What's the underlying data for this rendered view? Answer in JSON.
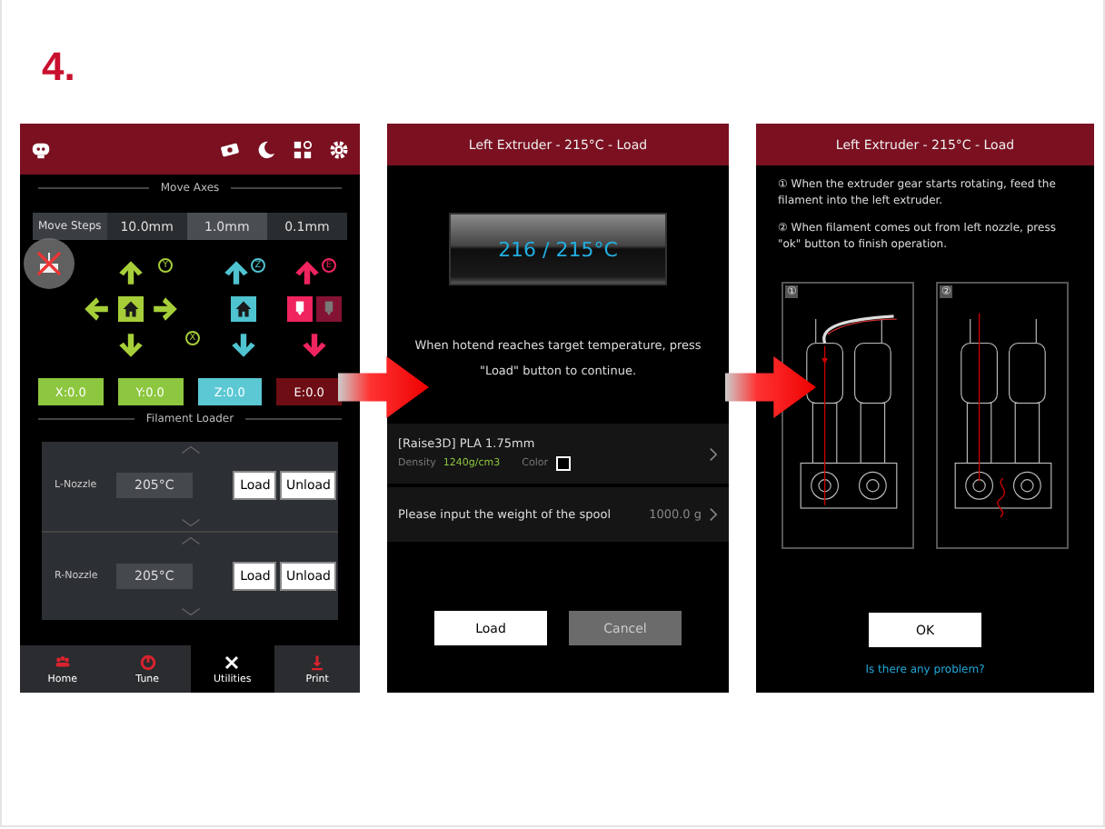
{
  "heading": "4.",
  "utilities_screen": {
    "move_axes_title": "Move Axes",
    "move_steps": {
      "label": "Move Steps",
      "options": [
        {
          "label": "10.0mm",
          "selected": false
        },
        {
          "label": "1.0mm",
          "selected": true
        },
        {
          "label": "0.1mm",
          "selected": false
        }
      ]
    },
    "jog_groups": [
      {
        "badges": [
          "Y",
          "X"
        ],
        "color": "#a6ce39"
      },
      {
        "badges": [
          "Z"
        ],
        "color": "#4fc3d0"
      },
      {
        "badges": [
          "E"
        ],
        "color": "#f0245e"
      }
    ],
    "axis_readouts": [
      {
        "label": "X:0.0",
        "color": "#8dc63f"
      },
      {
        "label": "Y:0.0",
        "color": "#8dc63f"
      },
      {
        "label": "Z:0.0",
        "color": "#5bc8d4"
      },
      {
        "label": "E:0.0",
        "color": "#6e0d14"
      }
    ],
    "filament_loader_title": "Filament Loader",
    "nozzles": [
      {
        "label": "L-Nozzle",
        "temperature": "205°C",
        "buttons": [
          "Load",
          "Unload"
        ]
      },
      {
        "label": "R-Nozzle",
        "temperature": "205°C",
        "buttons": [
          "Load",
          "Unload"
        ]
      }
    ],
    "tabs": [
      {
        "label": "Home",
        "selected": false
      },
      {
        "label": "Tune",
        "selected": false
      },
      {
        "label": "Utilities",
        "selected": true
      },
      {
        "label": "Print",
        "selected": false
      }
    ]
  },
  "load_screen": {
    "title": "Left Extruder - 215°C - Load",
    "temperature": "216 / 215°C",
    "message": "When hotend reaches target temperature, press \"Load\" button to continue.",
    "filament": {
      "name": "[Raise3D] PLA 1.75mm",
      "density_label": "Density",
      "density": "1240g/cm3",
      "color_label": "Color"
    },
    "spool": {
      "label": "Please input the weight of the spool",
      "value": "1000.0 g"
    },
    "buttons": [
      {
        "label": "Load",
        "primary": true
      },
      {
        "label": "Cancel",
        "primary": false
      }
    ]
  },
  "instruction_screen": {
    "title": "Left Extruder - 215°C - Load",
    "steps": [
      "① When the extruder gear starts rotating, feed the filament into the left extruder.",
      "② When filament comes out from left nozzle, press \"ok\" button to finish operation."
    ],
    "diagram_labels": [
      "①",
      "②"
    ],
    "button": "OK",
    "help_link": "Is there any problem?"
  }
}
